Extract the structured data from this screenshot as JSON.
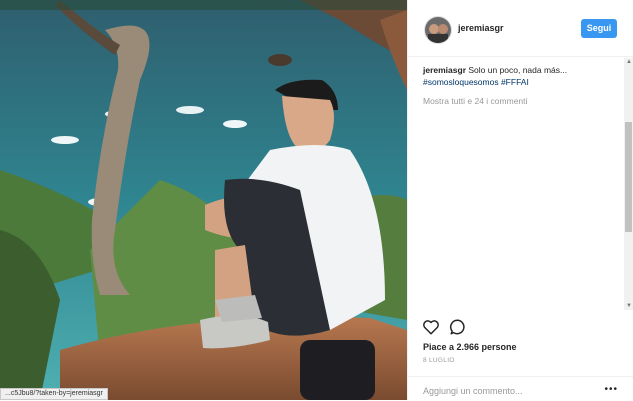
{
  "header": {
    "username": "jeremiasgr",
    "follow_label": "Segui"
  },
  "caption": {
    "username": "jeremiasgr",
    "text": " Solo un poco, nada más...",
    "hashtags": "#somosloquesomos #FFFAI"
  },
  "view_all_comments": "Mostra tutti e 24 i commenti",
  "actions": {
    "like_icon": "heart-icon",
    "comment_icon": "comment-bubble-icon"
  },
  "likes_text": "Piace a 2.966 persone",
  "date_text": "8 LUGLIO",
  "add_comment_placeholder": "Aggiungi un commento...",
  "more_options": "•••",
  "status_url": "...c5Jbu8/?taken-by=jeremiasgr",
  "colors": {
    "follow_button": "#3897f0",
    "hashtag": "#003569",
    "secondary_text": "#999999"
  }
}
